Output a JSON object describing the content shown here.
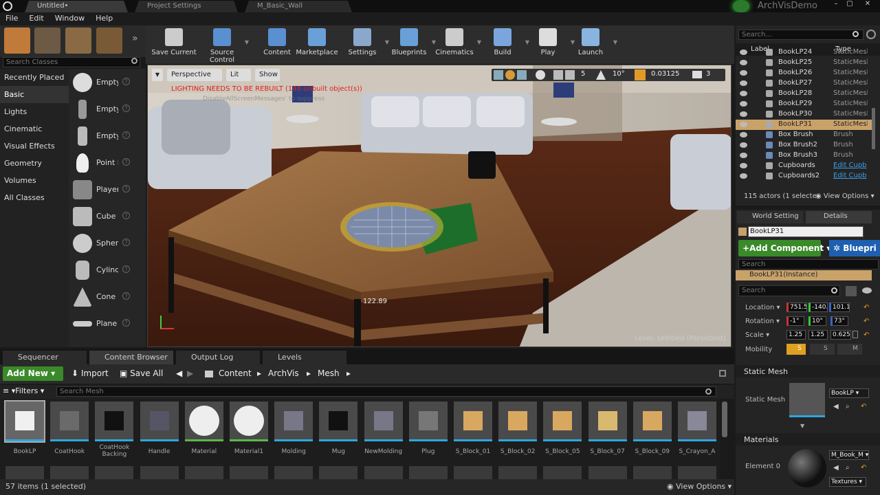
{
  "titlebar": {
    "tabs": [
      "Untitled•",
      "Project Settings",
      "M_Basic_Wall"
    ],
    "project_name": "ArchVisDemo"
  },
  "menu": [
    "File",
    "Edit",
    "Window",
    "Help"
  ],
  "modes": {
    "search_placeholder": "Search Classes",
    "categories": [
      "Recently Placed",
      "Basic",
      "Lights",
      "Cinematic",
      "Visual Effects",
      "Geometry",
      "Volumes",
      "All Classes"
    ],
    "active_category": "Basic",
    "items": [
      "Empty",
      "Empty",
      "Empty",
      "Point L",
      "Player",
      "Cube",
      "Sphere",
      "Cylinde",
      "Cone",
      "Plane"
    ]
  },
  "toolbar": [
    {
      "label": "Save Current",
      "icon": "save-icon",
      "dropdown": false
    },
    {
      "label": "Source Control",
      "icon": "source-control-icon",
      "dropdown": true
    },
    {
      "label": "Content",
      "icon": "content-icon",
      "dropdown": false
    },
    {
      "label": "Marketplace",
      "icon": "marketplace-icon",
      "dropdown": false
    },
    {
      "label": "Settings",
      "icon": "settings-icon",
      "dropdown": true
    },
    {
      "label": "Blueprints",
      "icon": "blueprints-icon",
      "dropdown": true
    },
    {
      "label": "Cinematics",
      "icon": "cinematics-icon",
      "dropdown": true
    },
    {
      "label": "Build",
      "icon": "build-icon",
      "dropdown": true
    },
    {
      "label": "Play",
      "icon": "play-icon",
      "dropdown": true
    },
    {
      "label": "Launch",
      "icon": "launch-icon",
      "dropdown": true
    }
  ],
  "viewport": {
    "perspective": "Perspective",
    "lit": "Lit",
    "show": "Show",
    "grid_snap": "5",
    "rotation_snap": "10°",
    "scale_snap": "0.03125",
    "camera_speed": "3",
    "warning": "LIGHTING NEEDS TO BE REBUILT (148 unbuilt object(s))",
    "warning_sub": "DisableAllScreenMessages' to suppress",
    "measure": "122.89",
    "level": "Level: Untitled (Persistent)"
  },
  "bottom_tabs": [
    "Sequencer",
    "Content Browser",
    "Output Log",
    "Levels"
  ],
  "content_browser": {
    "add_new": "Add New",
    "import": "Import",
    "save_all": "Save All",
    "path": [
      "Content",
      "ArchVis",
      "Mesh"
    ],
    "filters": "Filters",
    "search_placeholder": "Search Mesh",
    "assets": [
      "BookLP",
      "CoatHook",
      "CoatHook Backing",
      "Handle",
      "Material",
      "Material1",
      "Molding",
      "Mug",
      "NewMolding",
      "Plug",
      "S_Block_01",
      "S_Block_02",
      "S_Block_05",
      "S_Block_07",
      "S_Block_09",
      "S_Crayon_A"
    ],
    "status": "57 items (1 selected)",
    "view_options": "View Options"
  },
  "outliner": {
    "search_placeholder": "Search...",
    "col_label": "Label",
    "col_type": "Type",
    "rows": [
      {
        "name": "BookLP24",
        "type": "StaticMesh"
      },
      {
        "name": "BookLP25",
        "type": "StaticMesh"
      },
      {
        "name": "BookLP26",
        "type": "StaticMesh"
      },
      {
        "name": "BookLP27",
        "type": "StaticMesh"
      },
      {
        "name": "BookLP28",
        "type": "StaticMesh"
      },
      {
        "name": "BookLP29",
        "type": "StaticMesh"
      },
      {
        "name": "BookLP30",
        "type": "StaticMesh"
      },
      {
        "name": "BookLP31",
        "type": "StaticMesh"
      },
      {
        "name": "Box Brush",
        "type": "Brush"
      },
      {
        "name": "Box Brush2",
        "type": "Brush"
      },
      {
        "name": "Box Brush3",
        "type": "Brush"
      },
      {
        "name": "Cupboards",
        "type": "Edit Cupb"
      },
      {
        "name": "Cupboards2",
        "type": "Edit Cupb"
      }
    ],
    "footer": "115 actors (1 selecte",
    "view_options": "View Options"
  },
  "details": {
    "tabs": [
      "World Setting",
      "Details"
    ],
    "name": "BookLP31",
    "add_component": "Add Component",
    "blueprint": "Bluepri",
    "search_placeholder": "Search",
    "instance": "BookLP31(Instance)",
    "search2_placeholder": "Search",
    "location_label": "Location",
    "location": [
      "751.5",
      "-140.",
      "101.1"
    ],
    "rotation_label": "Rotation",
    "rotation": [
      "-1°",
      "10°",
      "73°"
    ],
    "scale_label": "Scale",
    "scale": [
      "1.25",
      "1.25",
      "0.625"
    ],
    "mobility_label": "Mobility",
    "mobility": [
      "S",
      "S",
      "M"
    ],
    "static_mesh_section": "Static Mesh",
    "static_mesh_label": "Static Mesh",
    "static_mesh_value": "BookLP",
    "materials_section": "Materials",
    "element_label": "Element 0",
    "material_value": "M_Book_M",
    "textures": "Textures"
  }
}
